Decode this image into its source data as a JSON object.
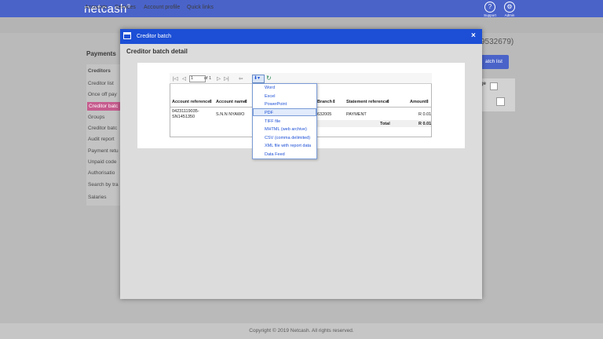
{
  "topbar": {
    "brand": "netcash",
    "brand_mark": "®",
    "support_label": "Support",
    "admin_label": "Admin"
  },
  "nav": {
    "items": [
      "Accounts",
      "Services",
      "Account profile",
      "Quick links"
    ]
  },
  "background": {
    "payments_title": "Payments",
    "sidebar": [
      "Creditors",
      "Creditor list",
      "Once off pay",
      "Creditor batc",
      "Groups",
      "Creditor batc",
      "Audit report",
      "Payment retu",
      "Unpaid code",
      "Authorisatio",
      "Search by tra",
      "Salaries"
    ],
    "right_title": "9532679)",
    "batch_list_button": "atch list",
    "panel_label": "ge"
  },
  "footer": {
    "text": "Copyright © 2019 Netcash. All rights reserved."
  },
  "modal": {
    "title": "Creditor batch",
    "close": "×",
    "detail_title": "Creditor batch detail"
  },
  "report": {
    "toolbar": {
      "first": "|◁",
      "prev": "◁",
      "page_value": "1",
      "of_label": "of 1",
      "next": "▷",
      "last": "▷|",
      "back": "⇦"
    },
    "columns": [
      "Account reference",
      "Account name",
      "Branch",
      "Statement reference",
      "Amount"
    ],
    "rows": [
      {
        "account_reference_line1": "04231119035-",
        "account_reference_line2": "SN1451350",
        "account_name": "S.N.N NYAWO",
        "branch": "632005",
        "statement_reference": "PAYMENT",
        "amount": "R 0.01"
      }
    ],
    "total_label": "Total",
    "total_amount": "R 0.01"
  },
  "export_menu": {
    "selected_index": 3,
    "items": [
      "Word",
      "Excel",
      "PowerPoint",
      "PDF",
      "TIFF file",
      "MHTML (web archive)",
      "CSV (comma delimited)",
      "XML file with report data",
      "Data Feed"
    ]
  }
}
